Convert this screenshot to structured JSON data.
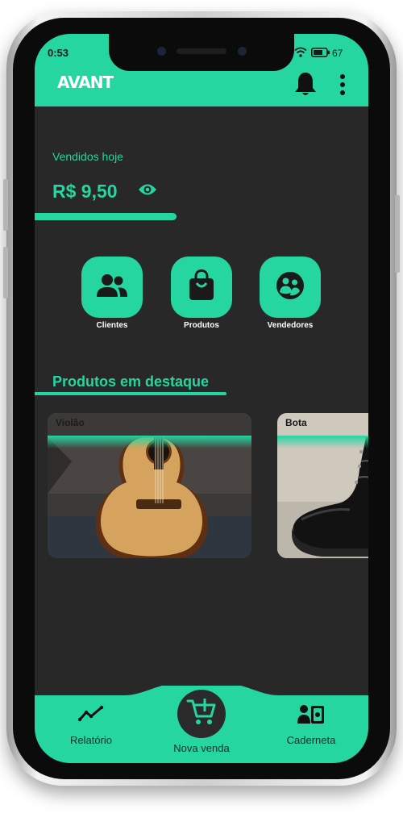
{
  "status_bar": {
    "time": "0:53",
    "battery": "67"
  },
  "app": {
    "title": "AVANT"
  },
  "sales": {
    "label": "Vendidos hoje",
    "amount": "R$ 9,50"
  },
  "actions": [
    {
      "label": "Clientes",
      "icon": "people-icon"
    },
    {
      "label": "Produtos",
      "icon": "shopping-bag-icon"
    },
    {
      "label": "Vendedores",
      "icon": "seller-icon"
    }
  ],
  "featured": {
    "title": "Produtos em destaque",
    "products": [
      {
        "name": "Violão",
        "image": "guitar-image"
      },
      {
        "name": "Bota",
        "image": "boot-image"
      }
    ]
  },
  "bottom_nav": {
    "items": [
      {
        "label": "Relatório",
        "icon": "trend-icon"
      },
      {
        "label": "Nova venda",
        "icon": "add-cart-icon"
      },
      {
        "label": "Caderneta",
        "icon": "wallet-contact-icon"
      }
    ]
  },
  "colors": {
    "accent": "#25d6a0",
    "background": "#282828",
    "text_dark": "#1a1a1a"
  }
}
